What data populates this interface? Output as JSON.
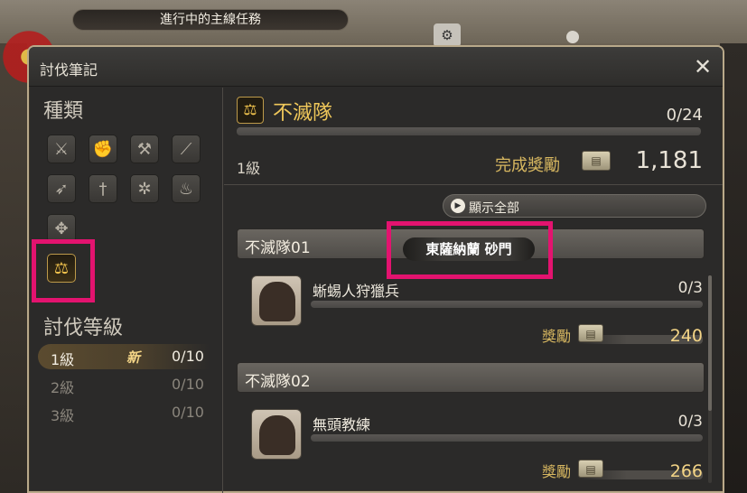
{
  "quest_bar": {
    "label": "進行中的主線任務"
  },
  "window": {
    "title": "討伐筆記"
  },
  "left": {
    "category_title": "種類",
    "categories": [
      {
        "icon": "crossed-swords-icon"
      },
      {
        "icon": "fist-icon"
      },
      {
        "icon": "axes-icon"
      },
      {
        "icon": "lance-icon"
      },
      {
        "icon": "bow-icon"
      },
      {
        "icon": "daggers-icon"
      },
      {
        "icon": "coral-icon"
      },
      {
        "icon": "fire-bowl-icon"
      },
      {
        "icon": "flame-emblem-icon"
      },
      {
        "icon": "scales-icon",
        "selected": true
      }
    ],
    "level_title": "討伐等級",
    "levels": [
      {
        "label": "1級",
        "new": "新",
        "progress": "0/10",
        "active": true
      },
      {
        "label": "2級",
        "new": "",
        "progress": "0/10",
        "active": false
      },
      {
        "label": "3級",
        "new": "",
        "progress": "0/10",
        "active": false
      }
    ]
  },
  "head": {
    "name": "不滅隊",
    "count": "0/24",
    "progress_fraction": 0,
    "level": "1級",
    "reward_label": "完成獎勵",
    "reward_value": "1,181"
  },
  "show_all_label": "顯示全部",
  "groups": [
    {
      "header": "不滅隊01",
      "mob_name": "蜥蜴人狩獵兵",
      "count": "0/3",
      "progress_fraction": 0,
      "reward_label": "獎勵",
      "reward_value": "240"
    },
    {
      "header": "不滅隊02",
      "mob_name": "無頭教練",
      "count": "0/3",
      "progress_fraction": 0,
      "reward_label": "獎勵",
      "reward_value": "266"
    }
  ],
  "tooltip": {
    "text": "東薩納蘭 砂門"
  },
  "colors": {
    "highlight": "#e3136f",
    "accent_gold": "#f0c85a"
  }
}
